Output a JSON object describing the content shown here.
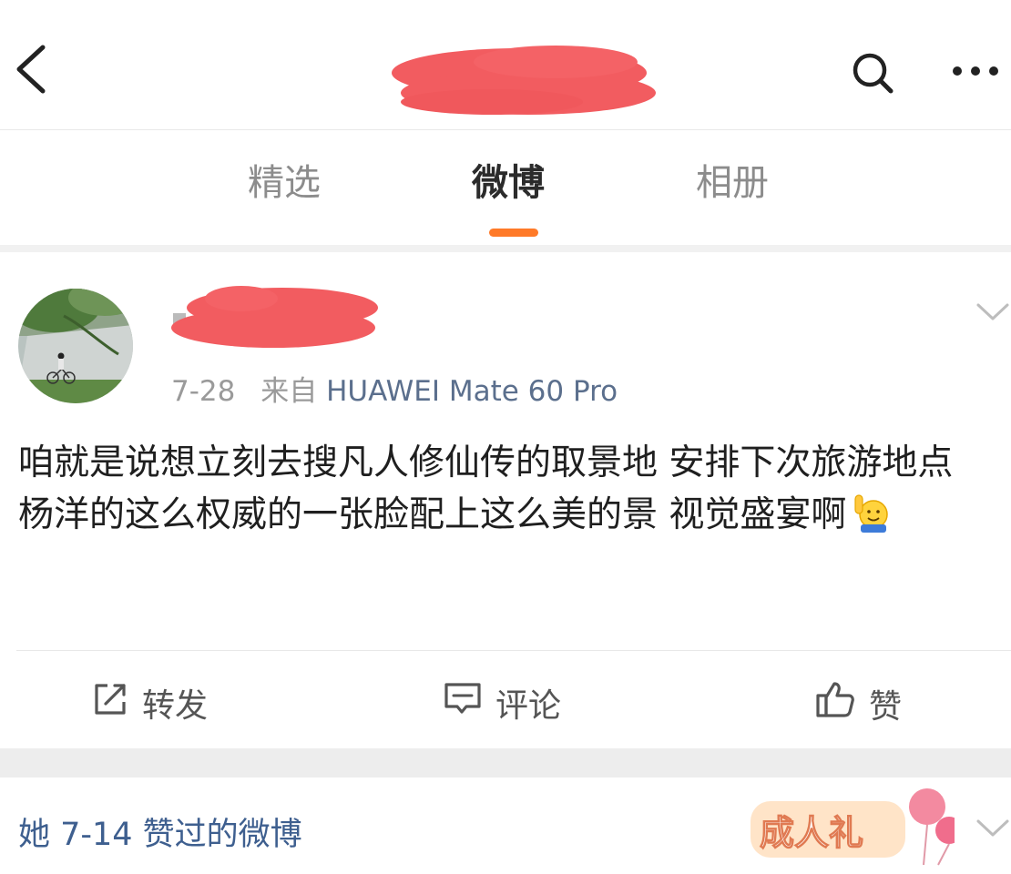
{
  "header": {
    "back_icon": "chevron-left-icon",
    "search_icon": "search-icon",
    "more_icon": "more-dots-icon",
    "title_redaction_color": "#f25c60"
  },
  "tabs": [
    {
      "label": "精选",
      "active": false
    },
    {
      "label": "微博",
      "active": true
    },
    {
      "label": "相册",
      "active": false
    }
  ],
  "accent_color": "#ff7a28",
  "post": {
    "name_redaction_color": "#f25c60",
    "date": "7-28",
    "source_prefix": "来自",
    "device": "HUAWEI Mate 60 Pro",
    "text": "咱就是说想立刻去搜凡人修仙传的取景地  安排下次旅游地点 杨洋的这么权威的一张脸配上这么美的景 视觉盛宴啊",
    "emoji": "raise-hand-emoji",
    "actions": {
      "repost": "转发",
      "comment": "评论",
      "like": "赞"
    }
  },
  "liked_section": {
    "title": "她 7-14 赞过的微博",
    "badge_text": "成人礼"
  }
}
